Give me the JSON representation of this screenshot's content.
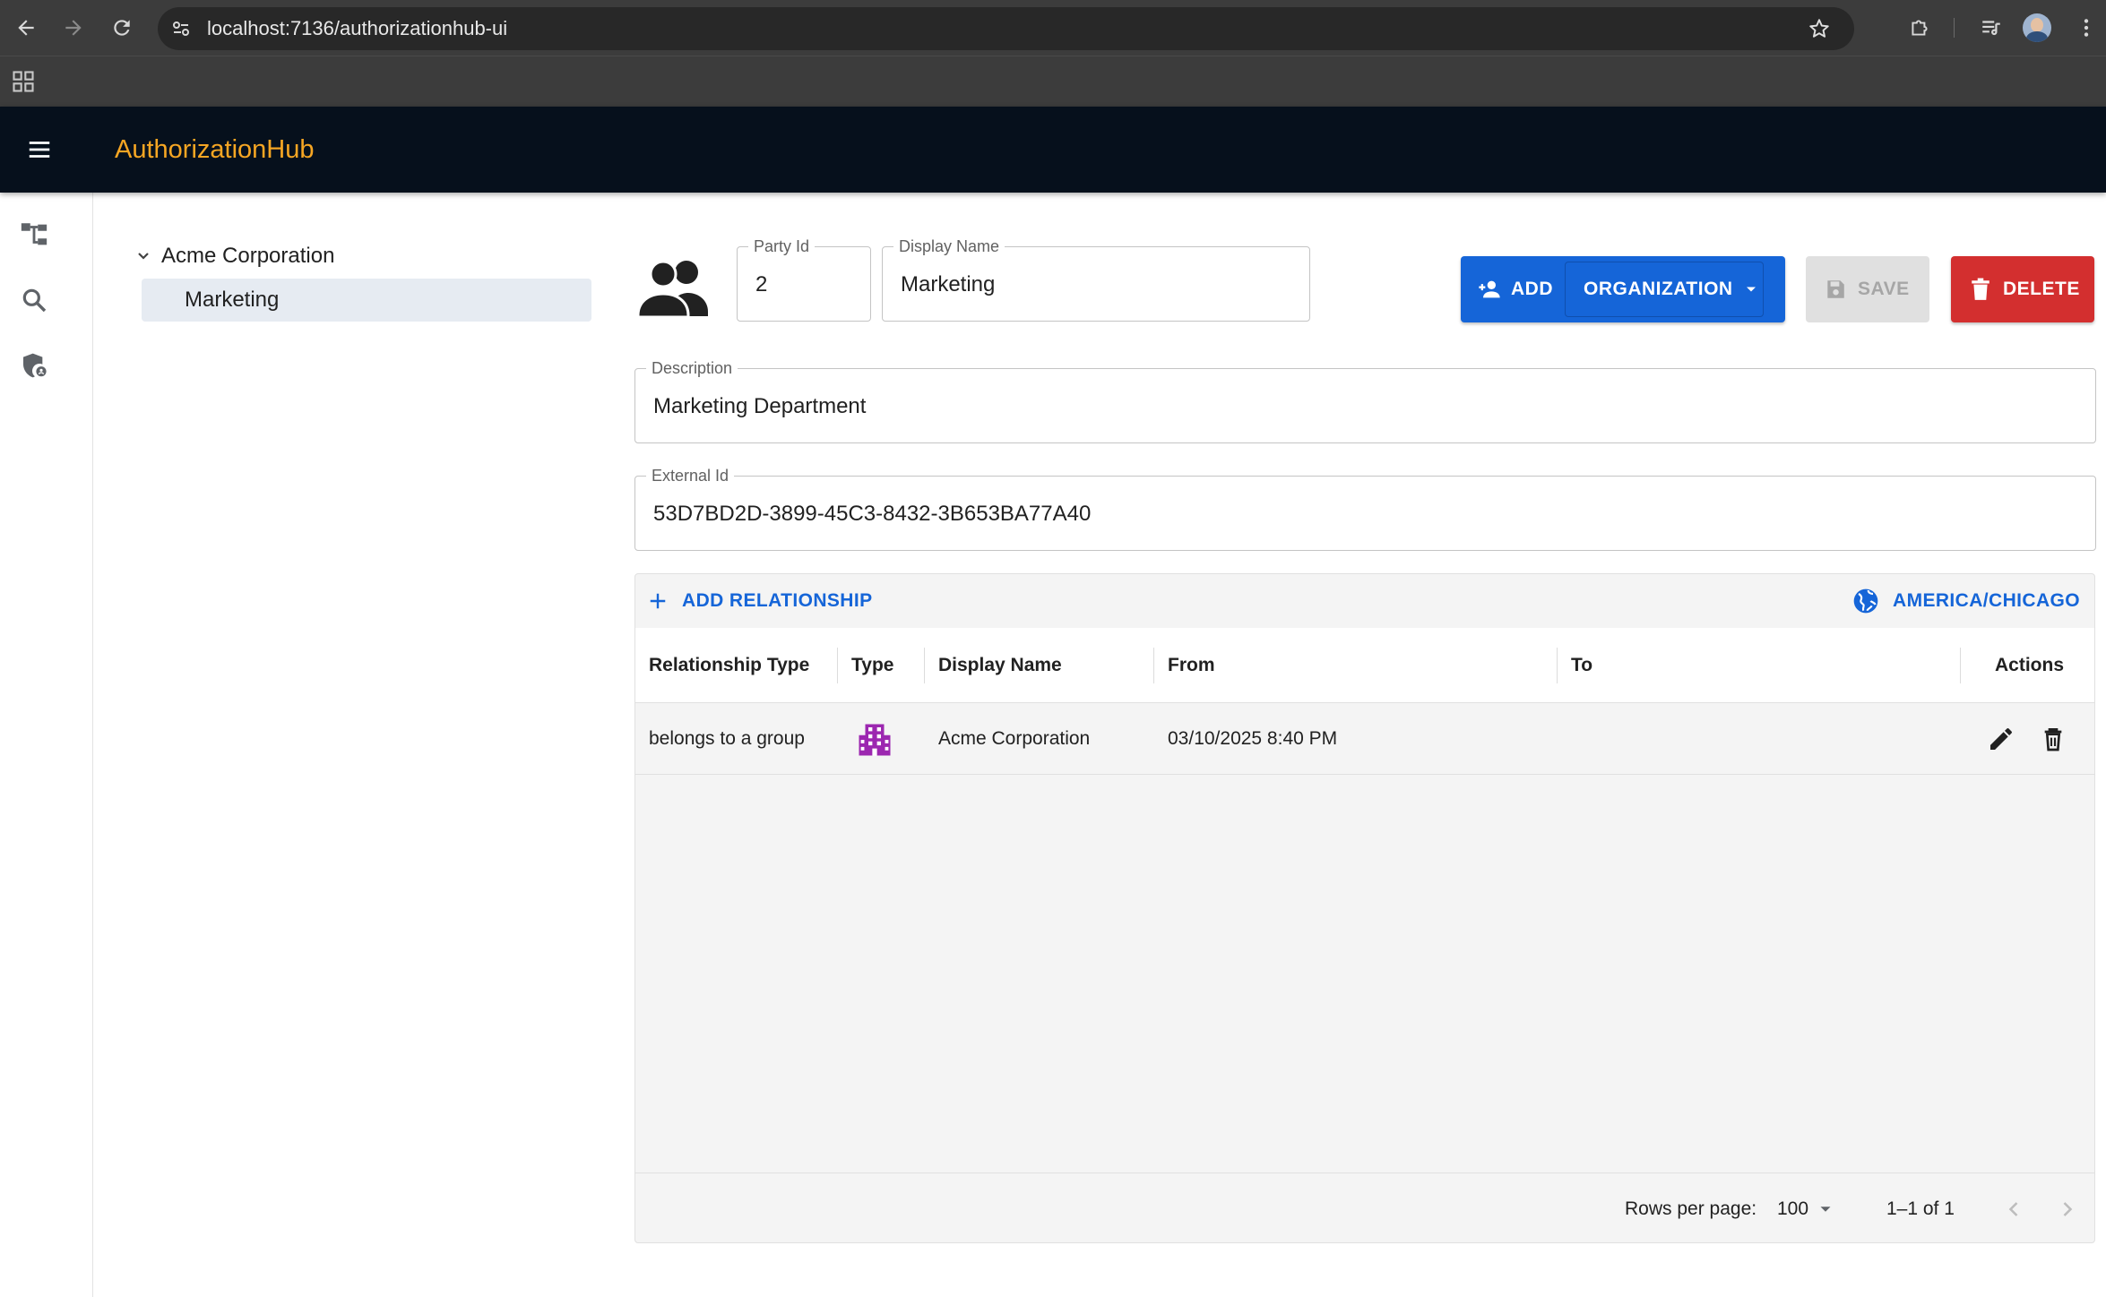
{
  "browser": {
    "url": "localhost:7136/authorizationhub-ui"
  },
  "app": {
    "title": "AuthorizationHub"
  },
  "tree": {
    "root_label": "Acme Corporation",
    "child_label": "Marketing"
  },
  "form": {
    "party_id_label": "Party Id",
    "party_id_value": "2",
    "display_name_label": "Display Name",
    "display_name_value": "Marketing",
    "description_label": "Description",
    "description_value": "Marketing Department",
    "external_id_label": "External Id",
    "external_id_value": "53D7BD2D-3899-45C3-8432-3B653BA77A40"
  },
  "actions": {
    "add_label": "ADD",
    "organization_label": "ORGANIZATION",
    "save_label": "SAVE",
    "delete_label": "DELETE"
  },
  "relationships": {
    "add_label": "ADD RELATIONSHIP",
    "timezone_label": "AMERICA/CHICAGO",
    "columns": {
      "relationship_type": "Relationship Type",
      "type": "Type",
      "display_name": "Display Name",
      "from": "From",
      "to": "To",
      "actions": "Actions"
    },
    "rows": [
      {
        "relationship_type": "belongs to a group",
        "type_icon": "organization-building-icon",
        "display_name": "Acme Corporation",
        "from": "03/10/2025 8:40 PM",
        "to": ""
      }
    ],
    "footer": {
      "rows_per_page_label": "Rows per page:",
      "rows_per_page_value": "100",
      "page_info": "1–1 of 1"
    }
  },
  "colors": {
    "accent_blue": "#1565d8",
    "delete_red": "#d32f2f",
    "brand_orange": "#f6a623",
    "appbar_bg": "#06101c",
    "org_icon_purple": "#9c27b0"
  }
}
